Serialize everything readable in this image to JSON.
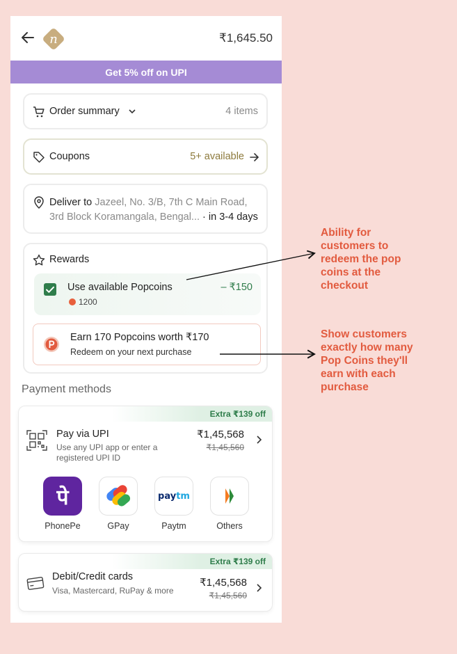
{
  "header": {
    "total_price": "₹1,645.50",
    "logo_letter": "n"
  },
  "promo_banner": "Get 5% off on UPI",
  "order_summary": {
    "label": "Order summary",
    "items": "4 items"
  },
  "coupons": {
    "label": "Coupons",
    "available": "5+ available"
  },
  "delivery": {
    "prefix": "Deliver to",
    "address_line1": "Jazeel, No. 3/B, 7th C Main Road,",
    "address_line2": "3rd Block Koramangala, Bengal...",
    "eta": " · in 3-4 days"
  },
  "rewards": {
    "title": "Rewards",
    "popcoins_label": "Use available Popcoins",
    "popcoins_discount": "– ₹150",
    "popcoins_balance": "1200",
    "earn_title": "Earn 170 Popcoins worth ₹170",
    "earn_subtitle": "Redeem on your next purchase"
  },
  "payment_methods": {
    "title": "Payment methods",
    "upi": {
      "extra": "Extra ₹139 off",
      "title": "Pay via UPI",
      "desc_line1": "Use any UPI app or enter a",
      "desc_line2": "registered UPI ID",
      "price": "₹1,45,568",
      "old_price": "₹1,45,560",
      "apps": [
        "PhonePe",
        "GPay",
        "Paytm",
        "Others"
      ]
    },
    "cards": {
      "extra": "Extra ₹139 off",
      "title": "Debit/Credit cards",
      "desc": "Visa, Mastercard, RuPay & more",
      "price": "₹1,45,568",
      "old_price": "₹1,45,560"
    }
  },
  "annotations": {
    "redeem": [
      "Ability for",
      "customers to",
      "redeem the pop",
      "coins at the",
      "checkout"
    ],
    "earn": [
      "Show customers",
      "exactly how many",
      "Pop Coins they'll",
      "earn with each",
      "purchase"
    ]
  },
  "colors": {
    "accent_green": "#2f7d4b",
    "promo_purple": "#a58bd5",
    "annotation": "#e25b3f",
    "background": "#f9dcd7"
  },
  "icons": [
    "back-arrow-icon",
    "brand-logo",
    "cart-icon",
    "chevron-down-icon",
    "tag-icon",
    "arrow-right-icon",
    "location-pin-icon",
    "star-icon",
    "checkbox-icon",
    "popcoin-icon",
    "qr-icon",
    "card-icon",
    "chevron-right-icon"
  ]
}
